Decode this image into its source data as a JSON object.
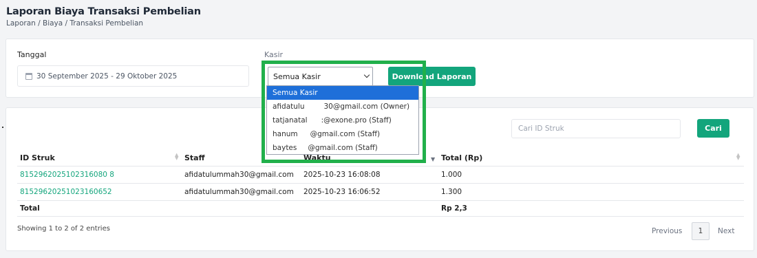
{
  "header": {
    "title": "Laporan Biaya Transaksi Pembelian",
    "breadcrumb": "Laporan / Biaya / Transaksi Pembelian"
  },
  "filters": {
    "date_label": "Tanggal",
    "date_value": "30 September 2025 - 29 Oktober 2025",
    "kasir_label": "Kasir",
    "kasir_selected": "Semua Kasir",
    "download_label": "Download Laporan",
    "kasir_options": [
      {
        "name": "Semua Kasir",
        "email": ""
      },
      {
        "name": "afidatulu",
        "email": "30@gmail.com (Owner)"
      },
      {
        "name": "tatjanatal",
        "email": ":@exone.pro (Staff)"
      },
      {
        "name": "hanum",
        "email": "@gmail.com (Staff)"
      },
      {
        "name": "baytes",
        "email": "@gmail.com (Staff)"
      }
    ]
  },
  "search": {
    "placeholder": "Cari ID Struk",
    "button_label": "Cari"
  },
  "table": {
    "columns": [
      "ID Struk",
      "Staff",
      "Waktu",
      "Total (Rp)"
    ],
    "rows": [
      {
        "id": "8152962025102316080 8",
        "staff": "afidatulummah30@gmail.com",
        "time": "2025-10-23 16:08:08",
        "total": "1.000"
      },
      {
        "id": "81529620251023160652",
        "staff": "afidatulummah30@gmail.com",
        "time": "2025-10-23 16:06:52",
        "total": "1.300"
      }
    ],
    "total_label": "Total",
    "total_value": "Rp 2,3"
  },
  "footer": {
    "entries_text": "Showing 1 to 2 of 2 entries",
    "prev_label": "Previous",
    "page": "1",
    "next_label": "Next"
  },
  "colors": {
    "accent": "#13a57c",
    "highlight": "#21b04b",
    "selection": "#1e6fd9"
  }
}
